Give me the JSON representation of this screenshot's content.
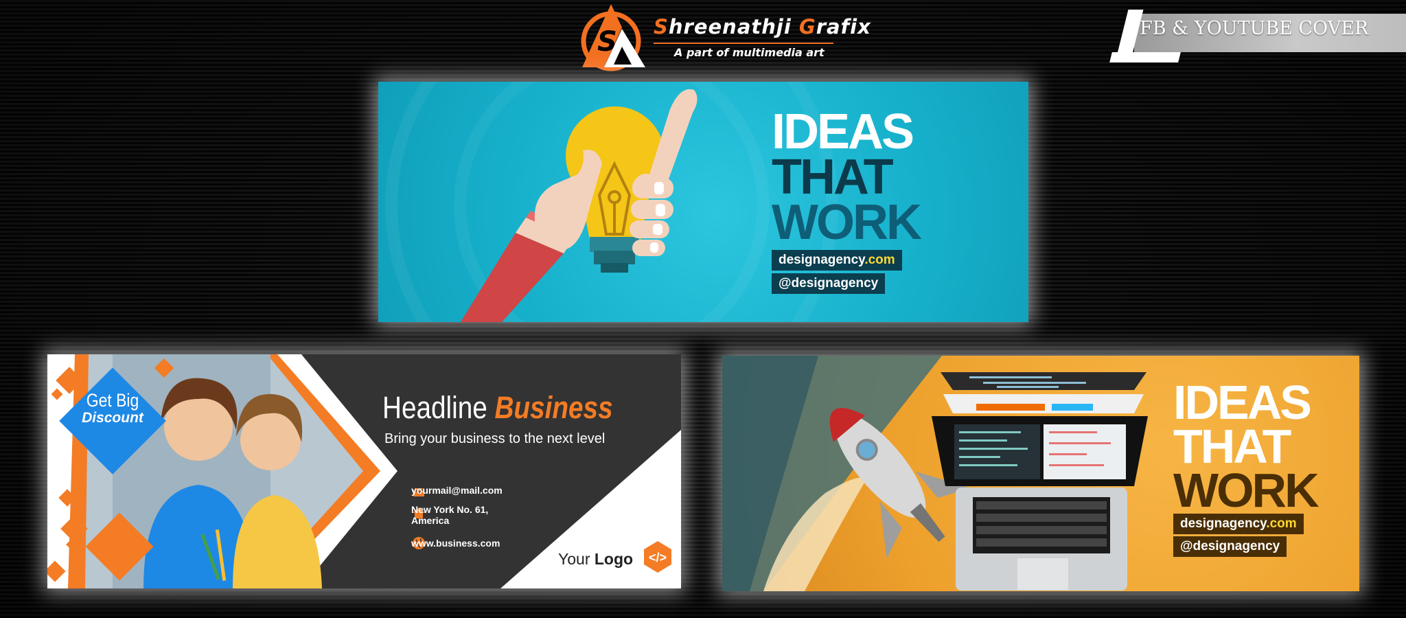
{
  "brand": {
    "name_first": "S",
    "name_mid1": "hreenathji ",
    "name_g": "G",
    "name_mid2": "rafix",
    "tagline": "A part of multimedia art"
  },
  "corner_label": "FB & YOUTUBE COVER",
  "cover1": {
    "headline": [
      "IDEAS",
      "THAT",
      "WORK"
    ],
    "site_name": "designagency",
    "site_tld": ".com",
    "handle": "@designagency"
  },
  "cover2": {
    "discount_line1": "Get Big",
    "discount_line2": "Discount",
    "headline_plain": "Headline ",
    "headline_accent": "Business",
    "subtitle": "Bring your business to  the next level",
    "email": "yourmail@mail.com",
    "address_line1": "New York No. 61,",
    "address_line2": "America",
    "website": "www.business.com",
    "logo_plain": "Your ",
    "logo_bold": "Logo"
  },
  "cover3": {
    "headline": [
      "IDEAS",
      "THAT",
      "WORK"
    ],
    "site_name": "designagency",
    "site_tld": ".com",
    "handle": "@designagency"
  },
  "colors": {
    "accent_orange": "#f37021",
    "cyan": "#17b1cc",
    "dark_teal": "#0b3e4f",
    "amber": "#eda02c",
    "dark_brown": "#4a2e05"
  }
}
